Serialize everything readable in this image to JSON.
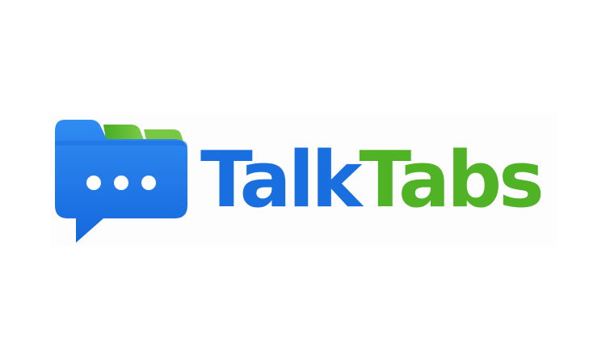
{
  "logo": {
    "brand_part_1": "Talk",
    "brand_part_2": "Tabs",
    "icon": "chat-bubble-folder-icon",
    "colors": {
      "primary_blue": "#1a6fe0",
      "blue_light": "#2f8cf2",
      "green": "#4fb325",
      "green_light": "#77c943",
      "dots": "#ffffff"
    }
  }
}
